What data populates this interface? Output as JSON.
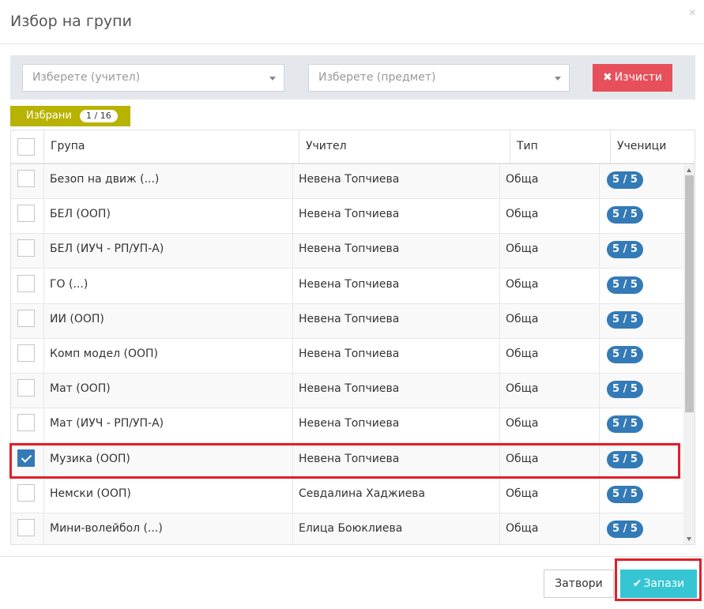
{
  "dialog": {
    "title": "Избор на групи",
    "close_symbol": "×"
  },
  "filters": {
    "teacher_placeholder": "Изберете (учител)",
    "subject_placeholder": "Изберете (предмет)",
    "clear_label": "Изчисти",
    "clear_icon": "✖"
  },
  "selected_tab": {
    "label": "Избрани",
    "count": "1 / 16"
  },
  "table": {
    "columns": [
      "Група",
      "Учител",
      "Тип",
      "Ученици"
    ],
    "rows": [
      {
        "group": "Безоп на движ (...)",
        "teacher": "Невена Топчиева",
        "type": "Обща",
        "students": "5 / 5",
        "checked": false
      },
      {
        "group": "БЕЛ (ООП)",
        "teacher": "Невена Топчиева",
        "type": "Обща",
        "students": "5 / 5",
        "checked": false
      },
      {
        "group": "БЕЛ (ИУЧ - РП/УП-А)",
        "teacher": "Невена Топчиева",
        "type": "Обща",
        "students": "5 / 5",
        "checked": false
      },
      {
        "group": "ГО (...)",
        "teacher": "Невена Топчиева",
        "type": "Обща",
        "students": "5 / 5",
        "checked": false
      },
      {
        "group": "ИИ (ООП)",
        "teacher": "Невена Топчиева",
        "type": "Обща",
        "students": "5 / 5",
        "checked": false
      },
      {
        "group": "Комп модел (ООП)",
        "teacher": "Невена Топчиева",
        "type": "Обща",
        "students": "5 / 5",
        "checked": false
      },
      {
        "group": "Мат (ООП)",
        "teacher": "Невена Топчиева",
        "type": "Обща",
        "students": "5 / 5",
        "checked": false
      },
      {
        "group": "Мат (ИУЧ - РП/УП-А)",
        "teacher": "Невена Топчиева",
        "type": "Обща",
        "students": "5 / 5",
        "checked": false
      },
      {
        "group": "Музика (ООП)",
        "teacher": "Невена Топчиева",
        "type": "Обща",
        "students": "5 / 5",
        "checked": true
      },
      {
        "group": "Немски (ООП)",
        "teacher": "Севдалина Хаджиева",
        "type": "Обща",
        "students": "5 / 5",
        "checked": false
      },
      {
        "group": "Мини-волейбол (...)",
        "teacher": "Елица Боюклиева",
        "type": "Обща",
        "students": "5 / 5",
        "checked": false
      }
    ]
  },
  "footer": {
    "close_label": "Затвори",
    "save_label": "Запази",
    "save_icon": "✔"
  },
  "colors": {
    "clear_button": "#e7505a",
    "selected_tab": "#b8b200",
    "badge": "#337ab7",
    "save_button": "#36c6d3",
    "highlight": "#e0202a"
  }
}
